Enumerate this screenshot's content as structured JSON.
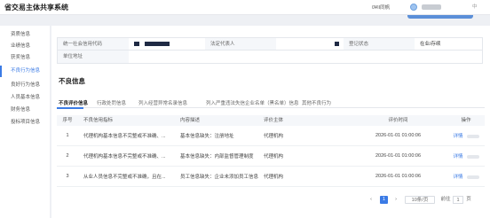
{
  "header": {
    "title": "省交易主体共享系统",
    "user_label": "0¥II同帆",
    "hint": "中"
  },
  "sidebar": {
    "items": [
      {
        "label": "资质信息",
        "active": false
      },
      {
        "label": "业绩信息",
        "active": false
      },
      {
        "label": "获奖信息",
        "active": false
      },
      {
        "label": "不良行为信息",
        "active": true
      },
      {
        "label": "良好行为信息",
        "active": false
      },
      {
        "label": "人员基本信息",
        "active": false
      },
      {
        "label": "财务信息",
        "active": false
      },
      {
        "label": "投标项目信息",
        "active": false
      }
    ]
  },
  "info": {
    "credit_code_label": "统一社会信用代码",
    "legal_rep_label": "法定代表人",
    "reg_status_label": "登记状态",
    "reg_status_value": "在业/存续",
    "address_label": "单位地址"
  },
  "section": {
    "title": "不良信息"
  },
  "tabs": [
    "不良评价信息",
    "行政处罚信息",
    "列入经营异常名录信息",
    "列入严重违法失信企业名单（黑名单）信息",
    "其他不良行为"
  ],
  "table": {
    "columns": [
      "序号",
      "不良信用指标",
      "内容描述",
      "评价主体",
      "评价时间",
      "操作"
    ],
    "rows": [
      {
        "no": "1",
        "indicator": "代理机构基本信息不完整或不准确、...",
        "desc": "基本信息缺失：注册地址",
        "subject": "代理机构",
        "time": "2026-01-01 01:00:06",
        "action": "详情"
      },
      {
        "no": "2",
        "indicator": "代理机构基本信息不完整或不准确、...",
        "desc": "基本信息缺失：内部监督管理制度",
        "subject": "代理机构",
        "time": "2026-01-01 01:00:06",
        "action": "详情"
      },
      {
        "no": "3",
        "indicator": "从业人员信息不完整或不准确，且在...",
        "desc": "员工信息缺失：企业未添加员工信息",
        "subject": "代理机构",
        "time": "2026-01-01 01:00:06",
        "action": "详情"
      }
    ]
  },
  "pagination": {
    "prev": "‹",
    "current": "1",
    "next": "›",
    "page_size": "10条/页",
    "goto_label": "前往",
    "goto_value": "1",
    "page_suffix": "页"
  },
  "colors": {
    "accent": "#3b7be5",
    "redaction": "#1f2a44"
  }
}
